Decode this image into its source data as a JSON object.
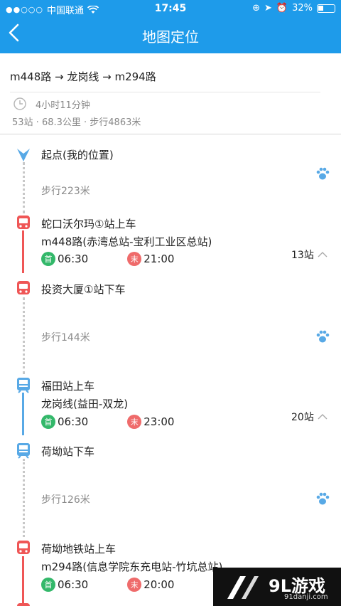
{
  "status_bar": {
    "carrier": "中国联通",
    "time": "17:45",
    "battery": "32%"
  },
  "nav": {
    "title": "地图定位"
  },
  "summary": {
    "route": "m448路 → 龙岗线 → m294路",
    "duration": "4小时11分钟",
    "meta": "53站 · 68.3公里 · 步行4863米"
  },
  "steps": {
    "start": "起点(我的位置)",
    "walk1": "步行223米",
    "board1": "蛇口沃尔玛①站上车",
    "line1": "m448路(赤湾总站-宝利工业区总站)",
    "first_label": "首",
    "last_label": "末",
    "first1": "06:30",
    "last1": "21:00",
    "count1": "13站",
    "alight1": "投资大厦①站下车",
    "walk2": "步行144米",
    "board2": "福田站上车",
    "line2": "龙岗线(益田-双龙)",
    "first2": "06:30",
    "last2": "23:00",
    "count2": "20站",
    "alight2": "荷坳站下车",
    "walk3": "步行126米",
    "board3": "荷坳地铁站上车",
    "line3": "m294路(信息学院东充电站-竹坑总站)",
    "first3": "06:30",
    "last3": "20:00"
  },
  "watermark": {
    "logo": "9L游戏",
    "url": "91danji.com"
  },
  "colors": {
    "primary": "#1e9bea",
    "bus": "#ef5656",
    "metro": "#58a9e6",
    "first_badge": "#33b86a",
    "last_badge": "#ef6b6b"
  }
}
